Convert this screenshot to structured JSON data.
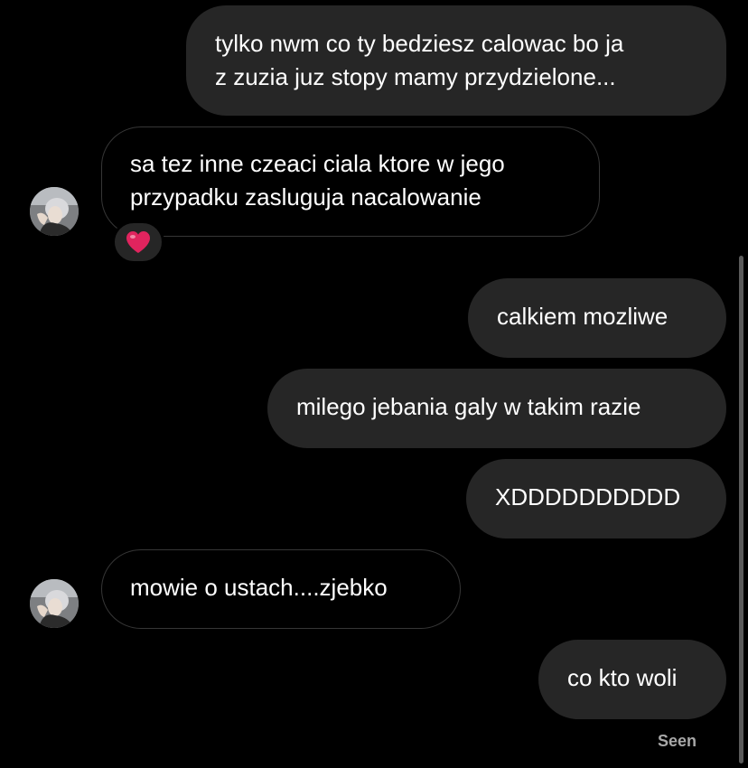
{
  "conversation": {
    "messages": [
      {
        "direction": "sent",
        "lines": [
          "tylko nwm co ty bedziesz calowac bo ja",
          "z zuzia juz stopy mamy przydzielone..."
        ]
      },
      {
        "direction": "received",
        "lines": [
          "sa tez inne czeaci ciala ktore w jego",
          "przypadku zasluguja nacalowanie"
        ],
        "reaction": "heart-emoji"
      },
      {
        "direction": "sent",
        "lines": [
          "calkiem mozliwe"
        ]
      },
      {
        "direction": "sent",
        "lines": [
          "milego jebania galy w takim razie"
        ]
      },
      {
        "direction": "sent",
        "lines": [
          "XDDDDDDDDDD"
        ]
      },
      {
        "direction": "received",
        "lines": [
          "mowie o ustach....zjebko"
        ]
      },
      {
        "direction": "sent",
        "lines": [
          "co kto woli"
        ]
      }
    ],
    "status": "Seen"
  },
  "colors": {
    "background": "#000000",
    "sent_bubble": "#262626",
    "received_border": "#363636",
    "text": "#ffffff",
    "status_text": "#a8a8a8",
    "heart": "#e0245e"
  },
  "icons": {
    "reaction": "heart-icon",
    "avatar": "contact-avatar"
  }
}
